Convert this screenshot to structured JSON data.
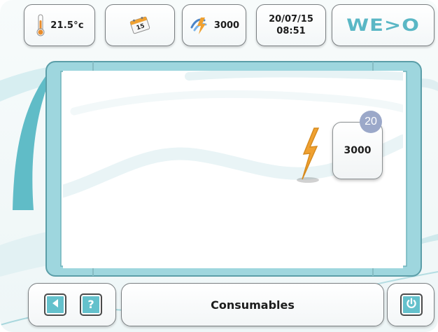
{
  "status_bar": {
    "temperature": "21.5°c",
    "calendar_day": "15",
    "power_value": "3000",
    "date": "20/07/15",
    "time": "08:51"
  },
  "brand": {
    "logo": "WE>O"
  },
  "main": {
    "power_display": "3000",
    "badge_count": "20"
  },
  "footer": {
    "title": "Consumables",
    "help_label": "?"
  },
  "icons": [
    "thermometer-icon",
    "calendar-icon",
    "power-sign-icon",
    "lightning-icon",
    "back-icon",
    "help-icon",
    "power-icon"
  ],
  "colors": {
    "accent": "#64c1cc",
    "logo": "#5ab7c5",
    "lightning": "#f0a131",
    "badge": "#9ba8c9"
  }
}
